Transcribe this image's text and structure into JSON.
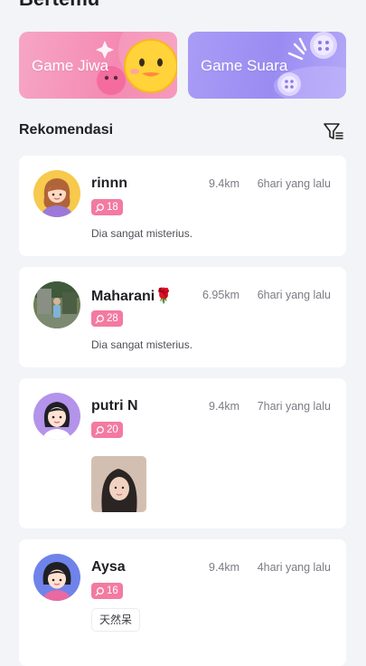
{
  "header": {
    "title": "Bertemu"
  },
  "games": [
    {
      "label": "Game Jiwa"
    },
    {
      "label": "Game Suara"
    }
  ],
  "section": {
    "title": "Rekomendasi"
  },
  "users": [
    {
      "name": "rinnn",
      "distance": "9.4km",
      "time": "6hari yang lalu",
      "badge": "18",
      "bio": "Dia sangat misterius."
    },
    {
      "name": "Maharani🌹",
      "distance": "6.95km",
      "time": "6hari yang lalu",
      "badge": "28",
      "bio": "Dia sangat misterius."
    },
    {
      "name": "putri N",
      "distance": "9.4km",
      "time": "7hari yang lalu",
      "badge": "20"
    },
    {
      "name": "Aysa",
      "distance": "9.4km",
      "time": "4hari yang lalu",
      "badge": "16",
      "tag": "天然呆"
    }
  ],
  "colors": {
    "badge": "#f37aa1",
    "game_jiwa": "#f48ab2",
    "game_suara": "#9a8bf2",
    "background": "#f3f4f7"
  },
  "icons": [
    "filter-icon",
    "search-icon",
    "smiley-emoji-icon",
    "heart-icon",
    "microphone-icon",
    "sparkle-icon"
  ]
}
